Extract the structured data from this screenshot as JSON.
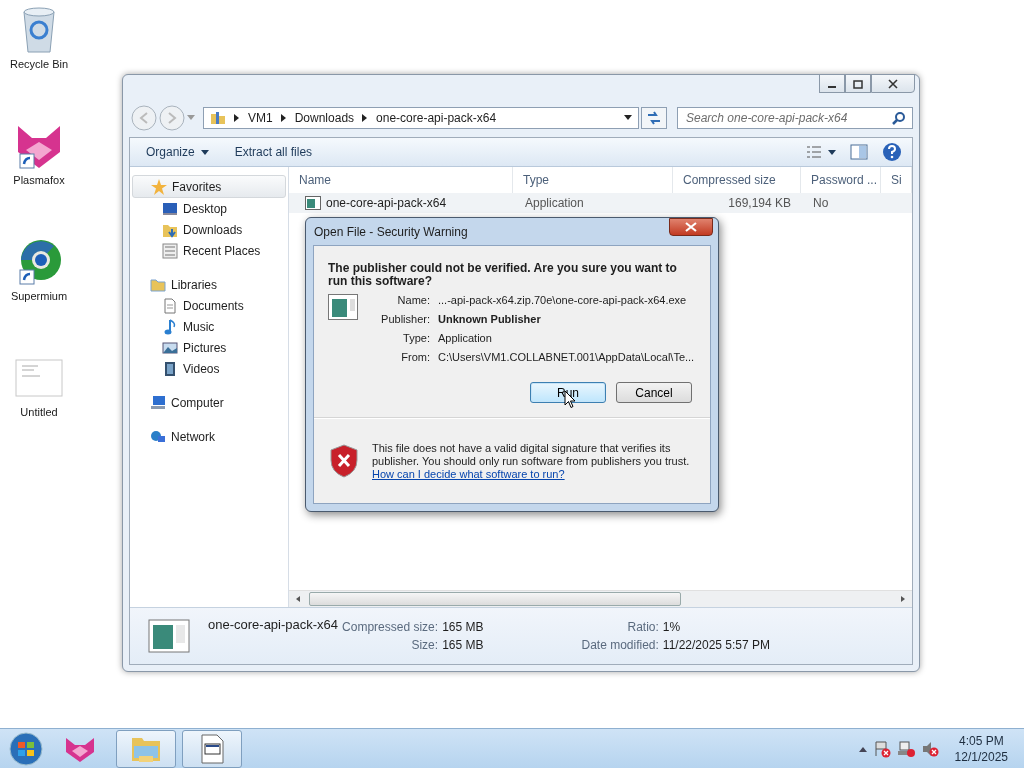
{
  "desktop_icons": [
    {
      "label": "Recycle Bin",
      "kind": "recycle"
    },
    {
      "label": "Plasmafox",
      "kind": "fox"
    },
    {
      "label": "Supermium",
      "kind": "browser"
    },
    {
      "label": "Untitled",
      "kind": "document"
    }
  ],
  "explorer": {
    "breadcrumb": [
      "VM1",
      "Downloads",
      "one-core-api-pack-x64"
    ],
    "search": {
      "placeholder": "Search one-core-api-pack-x64"
    },
    "toolbar": [
      {
        "label": "Organize",
        "dropdown": true
      },
      {
        "label": "Extract all files",
        "dropdown": false
      }
    ],
    "nav": [
      {
        "label": "Favorites",
        "kind": "favorites",
        "selected": true,
        "children": [
          {
            "label": "Desktop",
            "kind": "desktop",
            "selected": false
          },
          {
            "label": "Downloads",
            "kind": "downloads",
            "selected": false
          },
          {
            "label": "Recent Places",
            "kind": "recent",
            "selected": false
          }
        ]
      },
      {
        "label": "Libraries",
        "kind": "libraries",
        "selected": false,
        "children": [
          {
            "label": "Documents",
            "kind": "documents",
            "selected": false
          },
          {
            "label": "Music",
            "kind": "music",
            "selected": false
          },
          {
            "label": "Pictures",
            "kind": "pictures",
            "selected": false
          },
          {
            "label": "Videos",
            "kind": "videos",
            "selected": false
          }
        ]
      },
      {
        "label": "Computer",
        "kind": "computer",
        "selected": false
      },
      {
        "label": "Network",
        "kind": "network",
        "selected": false
      }
    ],
    "columns": [
      "Name",
      "Type",
      "Compressed size",
      "Password ...",
      "Si"
    ],
    "rows": [
      {
        "name": "one-core-api-pack-x64",
        "type": "Application",
        "compressed_size": "169,194 KB",
        "password": "No"
      }
    ],
    "details": {
      "name": "one-core-api-pack-x64",
      "fields": [
        {
          "label": "Compressed size:",
          "value": "165 MB"
        },
        {
          "label": "Size:",
          "value": "165 MB"
        },
        {
          "label": "Ratio:",
          "value": "1%"
        },
        {
          "label": "Date modified:",
          "value": "11/22/2025 5:57 PM"
        }
      ]
    }
  },
  "dialog": {
    "title": "Open File - Security Warning",
    "heading": "The publisher could not be verified.  Are you sure you want to run this software?",
    "fields": [
      {
        "label": "Name:",
        "value": "...-api-pack-x64.zip.70e\\one-core-api-pack-x64.exe",
        "emphasis": false
      },
      {
        "label": "Publisher:",
        "value": "Unknown Publisher",
        "emphasis": true
      },
      {
        "label": "Type:",
        "value": "Application",
        "emphasis": false
      },
      {
        "label": "From:",
        "value": "C:\\Users\\VM1.COLLABNET.001\\AppData\\Local\\Te...",
        "emphasis": false
      }
    ],
    "buttons": [
      {
        "label": "Run",
        "selected": true
      },
      {
        "label": "Cancel",
        "selected": false
      }
    ],
    "warning": "This file does not have a valid digital signature that verifies its publisher.  You should only run software from publishers you trust.",
    "link": "How can I decide what software to run?"
  },
  "taskbar": {
    "items": [
      {
        "kind": "fox",
        "open": false
      },
      {
        "kind": "explorer",
        "open": true
      },
      {
        "kind": "app",
        "open": true
      }
    ],
    "time": "4:05 PM",
    "date": "12/1/2025"
  }
}
